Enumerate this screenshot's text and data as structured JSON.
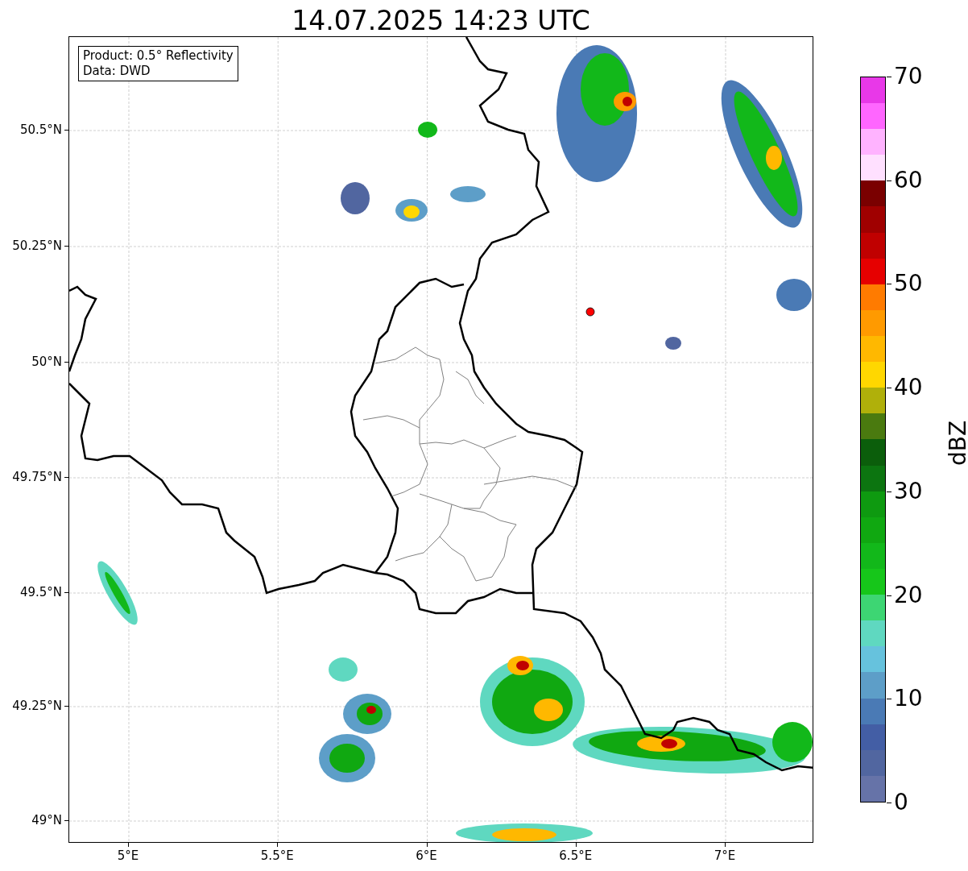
{
  "title": "14.07.2025 14:23 UTC",
  "map": {
    "legend": [
      "Product: 0.5° Reflectivity",
      "Data: DWD"
    ],
    "x_ticks": [
      "5°E",
      "5.5°E",
      "6°E",
      "6.5°E",
      "7°E"
    ],
    "y_ticks": [
      "50.5°N",
      "50.25°N",
      "50°N",
      "49.75°N",
      "49.5°N",
      "49.25°N",
      "49°N"
    ]
  },
  "colorbar": {
    "label": "dBZ",
    "ticks": [
      "70",
      "60",
      "50",
      "40",
      "30",
      "20",
      "10",
      "0"
    ],
    "segments": [
      {
        "color": "#6673a8"
      },
      {
        "color": "#5166a0"
      },
      {
        "color": "#435ea5"
      },
      {
        "color": "#4a7ab5"
      },
      {
        "color": "#5d9ec8"
      },
      {
        "color": "#66c2dd"
      },
      {
        "color": "#5fd8c0"
      },
      {
        "color": "#3dd673"
      },
      {
        "color": "#16c61a"
      },
      {
        "color": "#12b81a"
      },
      {
        "color": "#10a811"
      },
      {
        "color": "#0e9a10"
      },
      {
        "color": "#0c7510"
      },
      {
        "color": "#0b5e0b"
      },
      {
        "color": "#4a7a0f"
      },
      {
        "color": "#b0b00a"
      },
      {
        "color": "#ffd700"
      },
      {
        "color": "#ffb800"
      },
      {
        "color": "#ff9a00"
      },
      {
        "color": "#ff7b00"
      },
      {
        "color": "#e60000"
      },
      {
        "color": "#c00000"
      },
      {
        "color": "#a00000"
      },
      {
        "color": "#7a0000"
      },
      {
        "color": "#ffe0ff"
      },
      {
        "color": "#ffb3ff"
      },
      {
        "color": "#ff66ff"
      },
      {
        "color": "#e838e8"
      }
    ]
  }
}
